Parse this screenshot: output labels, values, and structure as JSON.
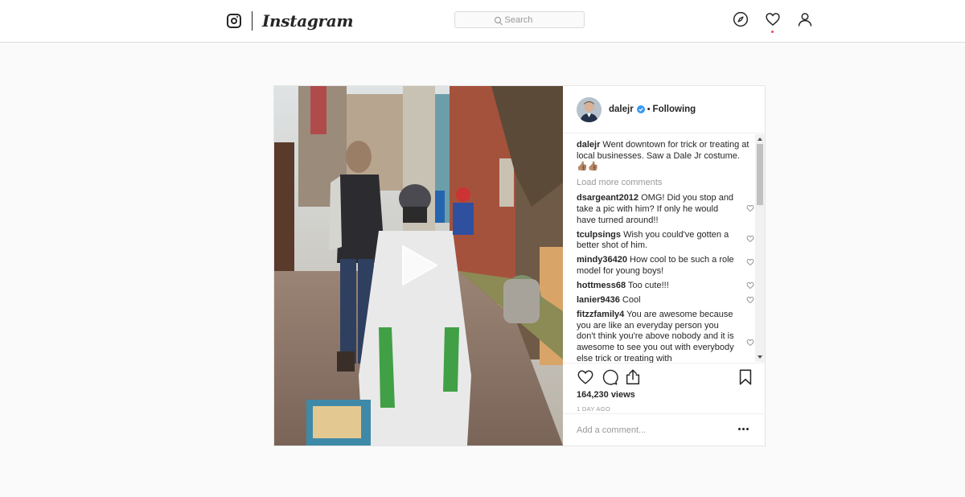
{
  "nav": {
    "logo_text": "Instagram",
    "search_placeholder": "Search",
    "icons": [
      "instagram-glyph-icon",
      "compass-icon",
      "heart-icon",
      "profile-icon"
    ]
  },
  "post": {
    "author": {
      "username": "dalejr",
      "verified": true,
      "separator": "•",
      "follow_status": "Following"
    },
    "caption": {
      "username": "dalejr",
      "text": "Went downtown for trick or treating at local businesses. Saw a Dale Jr costume.",
      "emoji": "👍🏽👍🏽"
    },
    "load_more": "Load more comments",
    "comments": [
      {
        "username": "dsargeant2012",
        "text": "OMG! Did you stop and take a pic with him? If only he would have turned around!!"
      },
      {
        "username": "tculpsings",
        "text": "Wish you could've gotten a better shot of him."
      },
      {
        "username": "mindy36420",
        "text": "How cool to be such a role model for young boys!"
      },
      {
        "username": "hottmess68",
        "text": "Too cute!!!"
      },
      {
        "username": "lanier9436",
        "text": "Cool"
      },
      {
        "username": "fitzzfamily4",
        "text": "You are awesome because you are like an everyday person you don't think you're above nobody and it is awesome to see you out with everybody else trick or treating with"
      }
    ],
    "views": "164,230 views",
    "time_ago": "1 DAY AGO",
    "add_comment_placeholder": "Add a comment...",
    "media_type": "video"
  },
  "colors": {
    "background": "#fafafa",
    "border": "#dbdbdb",
    "text": "#262626",
    "muted": "#999999",
    "verified": "#3897f0",
    "notification": "#ed4956"
  }
}
